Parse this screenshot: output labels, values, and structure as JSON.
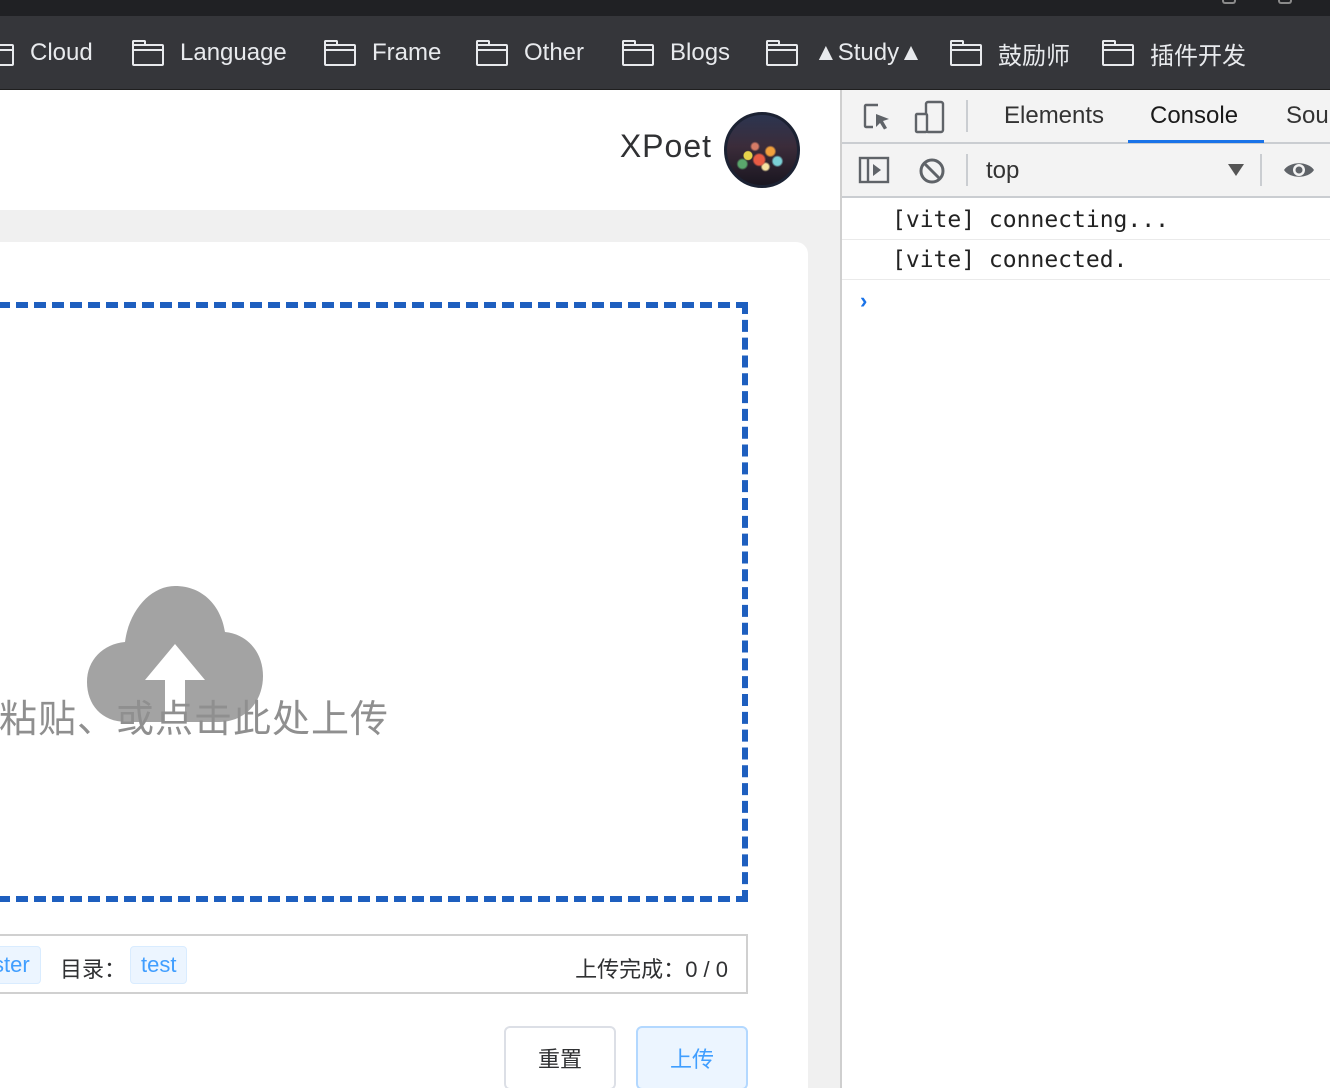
{
  "bookmarks": [
    {
      "label": "Cloud"
    },
    {
      "label": "Language"
    },
    {
      "label": "Frame"
    },
    {
      "label": "Other"
    },
    {
      "label": "Blogs"
    },
    {
      "label": "▲Study▲"
    },
    {
      "label": "鼓励师"
    },
    {
      "label": "插件开发"
    }
  ],
  "header": {
    "username": "XPoet"
  },
  "dropzone": {
    "hint": "、粘贴、或点击此处上传",
    "icon": "cloud-upload-icon"
  },
  "info_bar": {
    "branch_tag": "ster",
    "dir_label": "目录：",
    "dir_tag": "test",
    "status_label": "上传完成：",
    "status_value": "0 / 0"
  },
  "buttons": {
    "reset": "重置",
    "upload": "上传"
  },
  "devtools": {
    "tabs": [
      "Elements",
      "Console",
      "Sour"
    ],
    "active_tab": "Console",
    "context": "top",
    "console_lines": [
      "[vite] connecting...",
      "[vite] connected."
    ],
    "prompt": "›"
  },
  "colors": {
    "dropzone_border": "#1e5fbf",
    "accent": "#409eff",
    "devtools_active": "#1a73e8"
  }
}
